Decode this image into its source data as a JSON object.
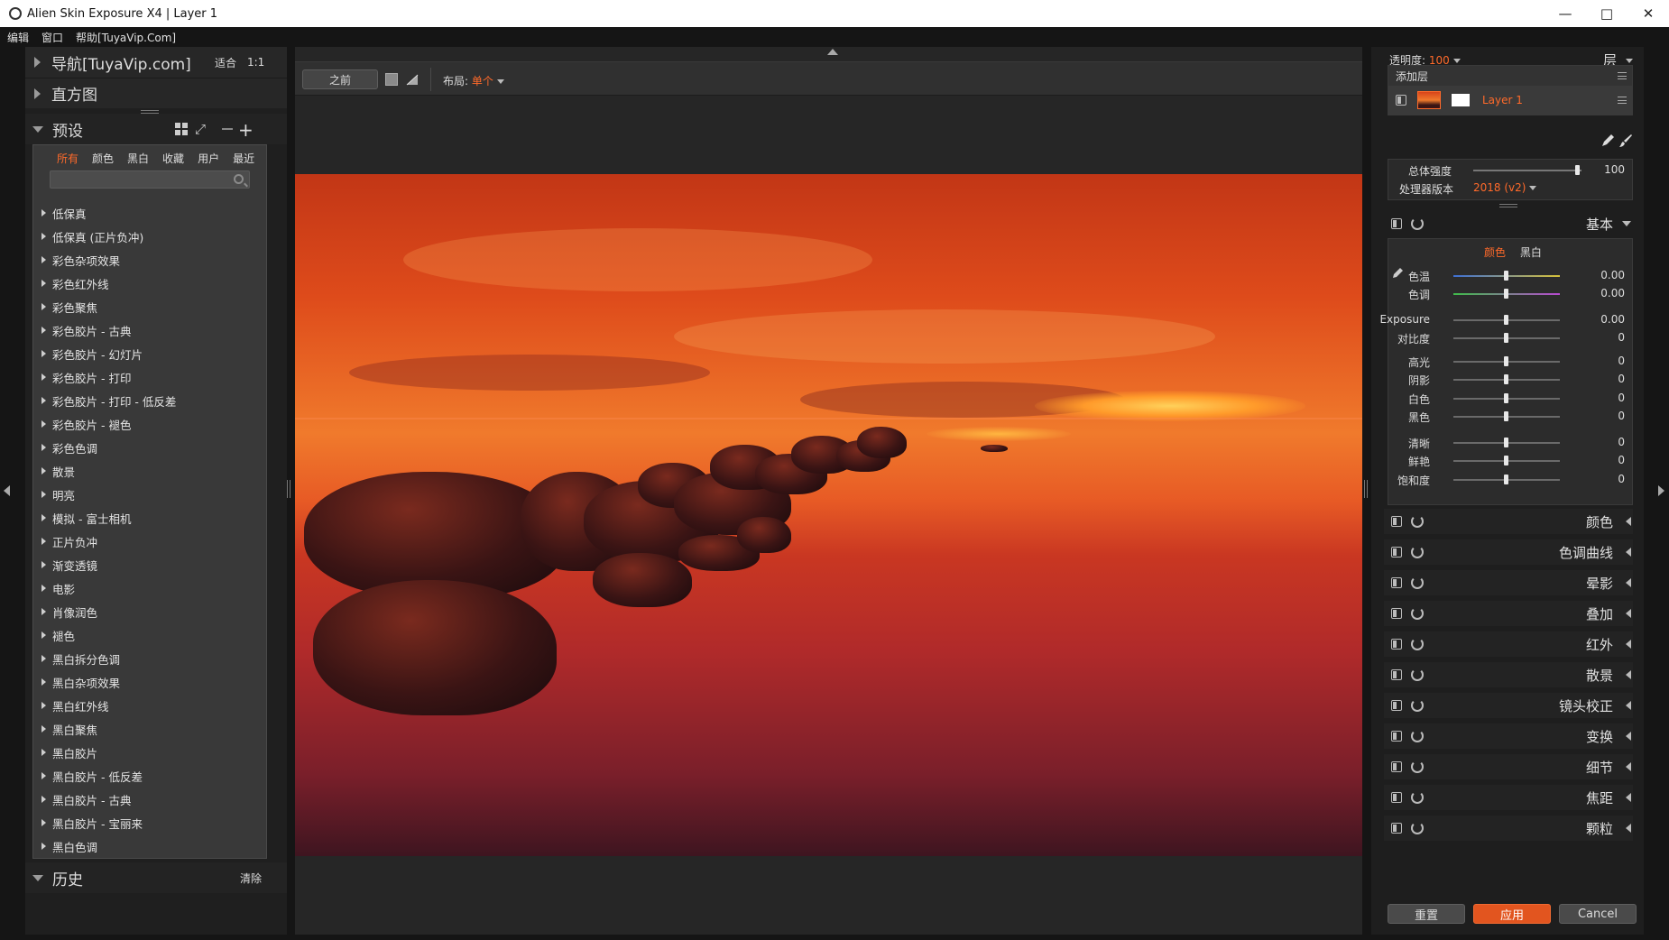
{
  "window": {
    "title": "Alien Skin Exposure X4 | Layer 1"
  },
  "menu": [
    "编辑",
    "窗口",
    "帮助[TuyaVip.Com]"
  ],
  "left": {
    "nav_label": "导航[TuyaVip.com]",
    "fit_label": "适合",
    "ratio_label": "1:1",
    "histogram_label": "直方图",
    "presets_label": "预设",
    "preset_tabs": [
      "所有",
      "颜色",
      "黑白",
      "收藏",
      "用户",
      "最近"
    ],
    "presets": [
      "低保真",
      "低保真 (正片负冲)",
      "彩色杂项效果",
      "彩色红外线",
      "彩色聚焦",
      "彩色胶片 - 古典",
      "彩色胶片 - 幻灯片",
      "彩色胶片 - 打印",
      "彩色胶片 - 打印 - 低反差",
      "彩色胶片 - 褪色",
      "彩色色调",
      "散景",
      "明亮",
      "模拟 - 富士相机",
      "正片负冲",
      "渐变透镜",
      "电影",
      "肖像润色",
      "褪色",
      "黑白拆分色调",
      "黑白杂项效果",
      "黑白红外线",
      "黑白聚焦",
      "黑白胶片",
      "黑白胶片 - 低反差",
      "黑白胶片 - 古典",
      "黑白胶片 - 宝丽来",
      "黑白色调"
    ],
    "history_label": "历史",
    "clear_label": "清除"
  },
  "toolbar": {
    "before_label": "之前",
    "layout_label": "布局:",
    "layout_value": "单个"
  },
  "right": {
    "opacity_label": "透明度:",
    "opacity_value": "100",
    "layers_label": "层",
    "add_layer_label": "添加层",
    "layer_name": "Layer 1",
    "strength_label": "总体强度",
    "strength_value": "100",
    "strength_fraction": 0.97,
    "processor_label": "处理器版本",
    "processor_value": "2018 (v2)",
    "basic_label": "基本",
    "basic_tabs": [
      "颜色",
      "黑白"
    ],
    "sliders": [
      {
        "name": "色温",
        "value": "0.00"
      },
      {
        "name": "色调",
        "value": "0.00"
      },
      {
        "name": "Exposure",
        "value": "0.00"
      },
      {
        "name": "对比度",
        "value": "0"
      },
      {
        "name": "高光",
        "value": "0"
      },
      {
        "name": "阴影",
        "value": "0"
      },
      {
        "name": "白色",
        "value": "0"
      },
      {
        "name": "黑色",
        "value": "0"
      },
      {
        "name": "清晰",
        "value": "0"
      },
      {
        "name": "鲜艳",
        "value": "0"
      },
      {
        "name": "饱和度",
        "value": "0"
      }
    ],
    "sections": [
      "颜色",
      "色调曲线",
      "晕影",
      "叠加",
      "红外",
      "散景",
      "镜头校正",
      "变换",
      "细节",
      "焦距",
      "颗粒"
    ],
    "reset_label": "重置",
    "apply_label": "应用",
    "cancel_label": "Cancel"
  },
  "colors": {
    "accent": "#ff6a2a",
    "panel": "#1f1f1f",
    "apply": "#e2551f"
  }
}
